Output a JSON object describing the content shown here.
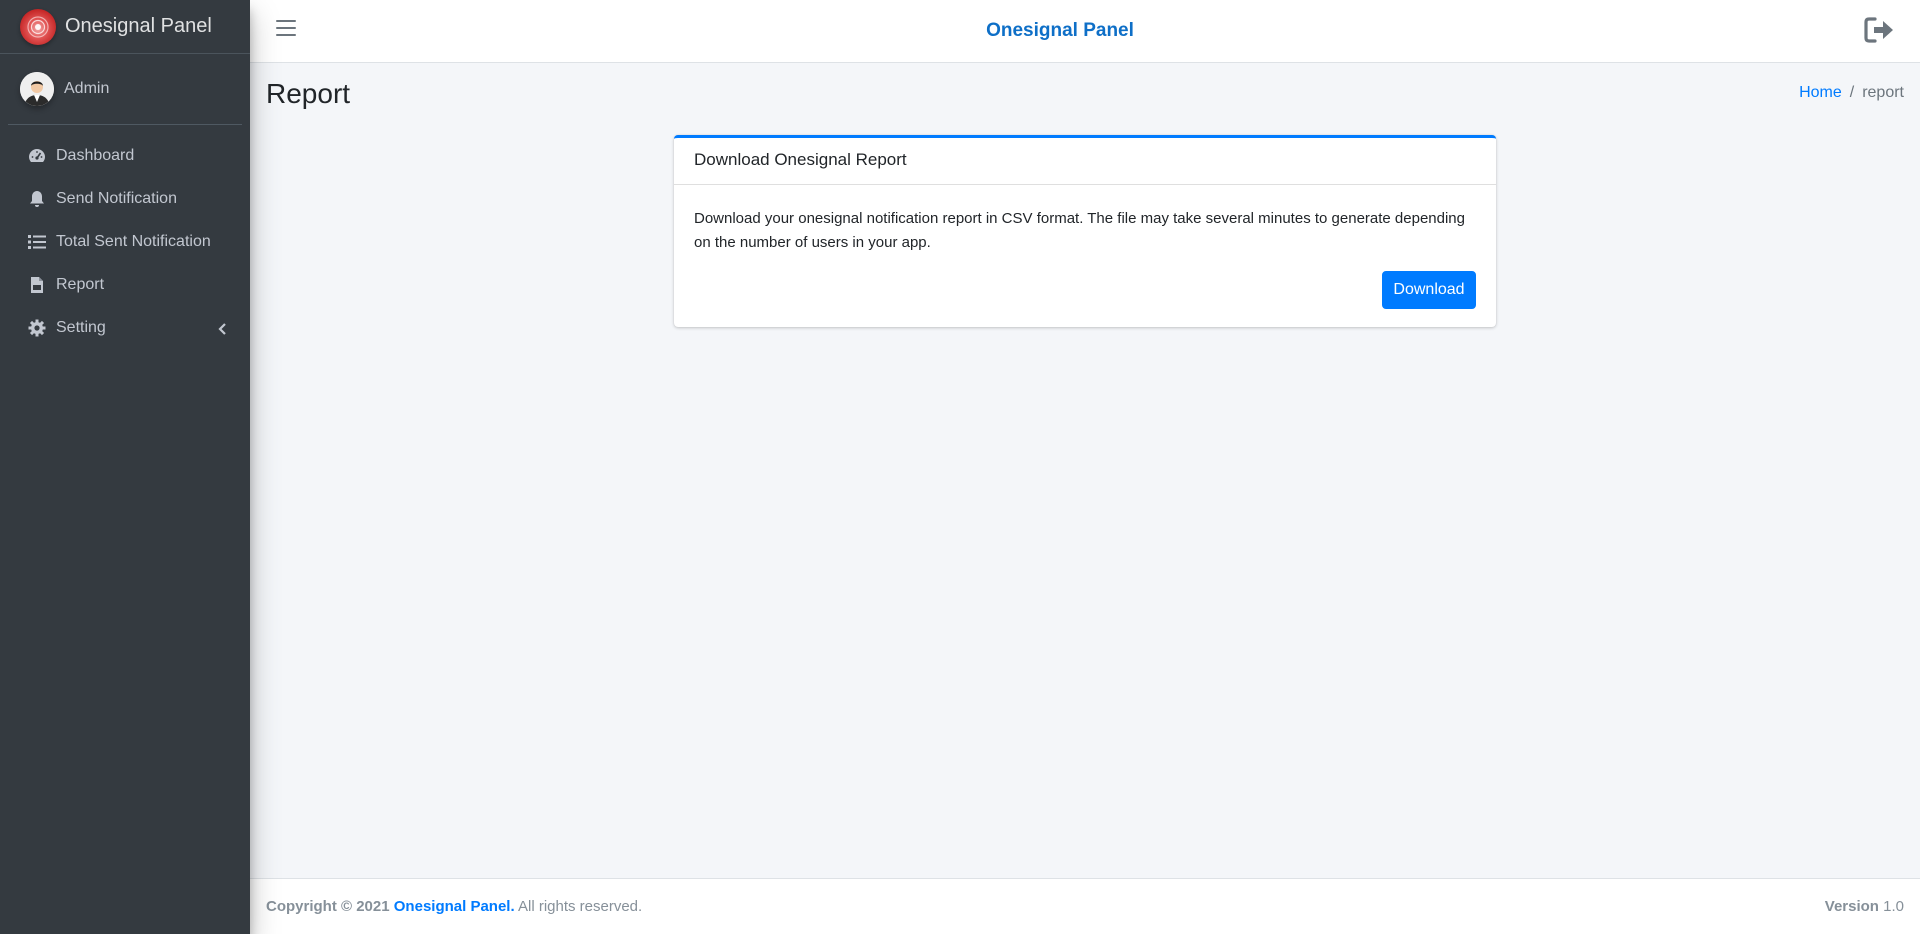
{
  "brand": {
    "title": "Onesignal Panel",
    "logo_icon": "onesignal-logo"
  },
  "user": {
    "name": "Admin",
    "avatar_icon": "user-avatar"
  },
  "sidebar": {
    "items": [
      {
        "label": "Dashboard",
        "icon": "tachometer-icon"
      },
      {
        "label": "Send Notification",
        "icon": "bell-icon"
      },
      {
        "label": "Total Sent Notification",
        "icon": "list-icon"
      },
      {
        "label": "Report",
        "icon": "file-csv-icon"
      },
      {
        "label": "Setting",
        "icon": "gear-icon",
        "caret": "chevron-left-icon"
      }
    ]
  },
  "topbar": {
    "title": "Onesignal Panel",
    "menu_icon": "hamburger-icon",
    "logout_icon": "sign-out-icon"
  },
  "page": {
    "title": "Report"
  },
  "breadcrumb": {
    "home": "Home",
    "separator": "/",
    "current": "report"
  },
  "card": {
    "title": "Download Onesignal Report",
    "text": "Download your onesignal notification report in CSV format. The file may take several minutes to generate depending on the number of users in your app.",
    "button": "Download"
  },
  "footer": {
    "copyright_prefix": "Copyright © 2021",
    "brand_link": "Onesignal Panel.",
    "rights": "All rights reserved.",
    "version_label": "Version",
    "version_value": "1.0"
  },
  "colors": {
    "sidebar_bg": "#343a40",
    "primary": "#007bff",
    "brand_title": "#0e6fc7",
    "content_bg": "#f4f6f9"
  }
}
